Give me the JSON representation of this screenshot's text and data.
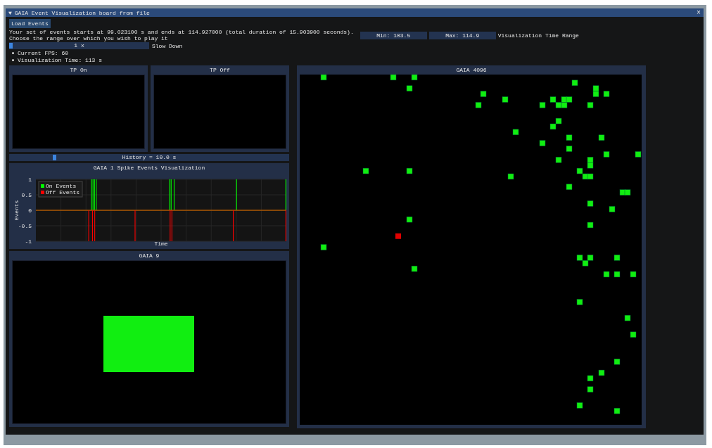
{
  "window": {
    "title": "GAIA Event Visualization board from file",
    "collapse_arrow": "▼",
    "close": "×"
  },
  "load_button": "Load Events",
  "description": [
    "Your set of events starts at 99.023100 s and ends at 114.927000 (total duration of 15.903900 seconds).",
    "Choose the range over which you wish to play it"
  ],
  "range": {
    "min": "Min: 103.5",
    "max": "Max: 114.9",
    "label": "Visualization Time Range"
  },
  "speed": {
    "value": "1 x",
    "level": 0,
    "label": "Slow Down"
  },
  "stats": [
    "Current FPS: 60",
    "Visualization Time: 113 s"
  ],
  "tp_panels": [
    {
      "title": "TP On"
    },
    {
      "title": "TP Off"
    }
  ],
  "history": {
    "value": "History = 10.0 s",
    "level": 0.16
  },
  "spike_panel": {
    "title": "GAIA 1 Spike Events Visualization",
    "xlabel": "Time",
    "ylabel": "Events",
    "yticks": [
      "1",
      "0.5",
      "0",
      "-0.5",
      "-1"
    ],
    "legend": [
      {
        "name": "On Events",
        "color": "#00ff00"
      },
      {
        "name": "Off Events",
        "color": "#ff0000"
      }
    ]
  },
  "gaia9": {
    "title": "GAIA 9",
    "active": true
  },
  "gaia4096": {
    "title": "GAIA 4096"
  }
}
